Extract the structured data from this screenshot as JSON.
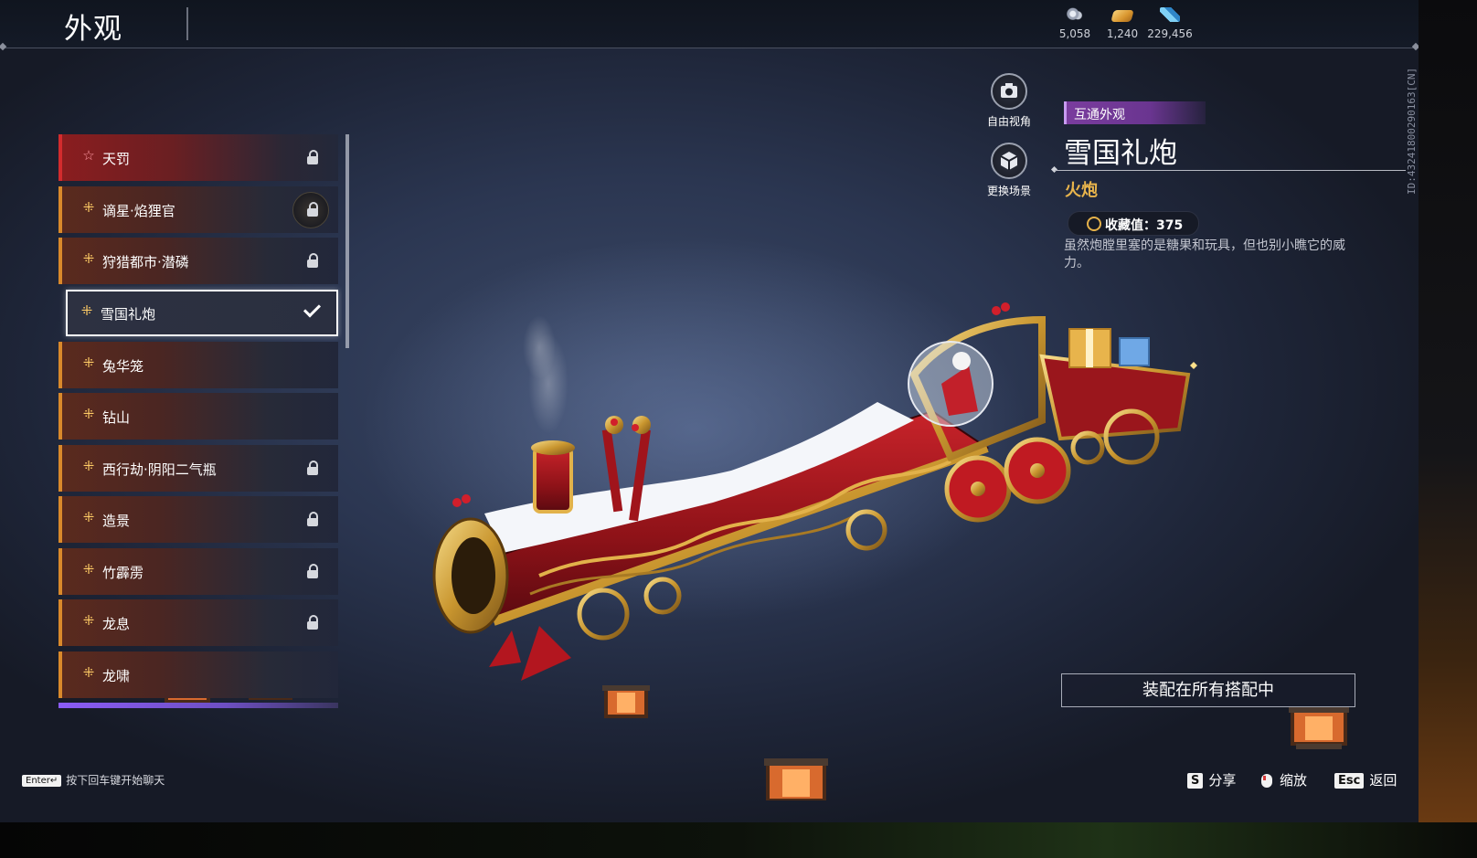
{
  "header": {
    "title": "外观",
    "currencies": [
      {
        "icon": "silver-coin-icon",
        "value": "5,058",
        "color": "#b9bfcc"
      },
      {
        "icon": "gold-ticket-icon",
        "value": "1,240",
        "color": "#e8b04a"
      },
      {
        "icon": "feather-crystal-icon",
        "value": "229,456",
        "color": "#5fb6e8"
      }
    ]
  },
  "side_id": "ID:4324180029016З[CN]",
  "skin_list": {
    "items": [
      {
        "label": "天罚",
        "icon": "star-icon",
        "locked": true,
        "rarity": "red"
      },
      {
        "label": "谪星·焰狸官",
        "icon": "rune-icon",
        "locked": true,
        "rarity": "gold"
      },
      {
        "label": "狩猎都市·潜磷",
        "icon": "rune-icon",
        "locked": true,
        "rarity": "gold"
      },
      {
        "label": "雪国礼炮",
        "icon": "rune-icon",
        "locked": false,
        "selected": true,
        "rarity": "gold"
      },
      {
        "label": "兔华笼",
        "icon": "rune-icon",
        "locked": false,
        "rarity": "gold"
      },
      {
        "label": "钻山",
        "icon": "rune-icon",
        "locked": false,
        "rarity": "gold"
      },
      {
        "label": "西行劫·阴阳二气瓶",
        "icon": "rune-icon",
        "locked": true,
        "rarity": "gold"
      },
      {
        "label": "造景",
        "icon": "rune-icon",
        "locked": true,
        "rarity": "gold"
      },
      {
        "label": "竹霹雳",
        "icon": "rune-icon",
        "locked": true,
        "rarity": "gold"
      },
      {
        "label": "龙息",
        "icon": "rune-icon",
        "locked": true,
        "rarity": "gold"
      },
      {
        "label": "龙啸",
        "icon": "rune-icon",
        "locked": false,
        "rarity": "gold"
      }
    ]
  },
  "view_controls": {
    "free_camera_label": "自由视角",
    "change_scene_label": "更换场景"
  },
  "details": {
    "tag": "互通外观",
    "name": "雪国礼炮",
    "type": "火炮",
    "collection_label": "收藏值：375",
    "description": "虽然炮膛里塞的是糖果和玩具，但也别小瞧它的威力。",
    "equip_button": "装配在所有搭配中"
  },
  "footer": {
    "chat_key": "Enter↵",
    "chat_hint": "按下回车键开始聊天",
    "share_key": "S",
    "share_label": "分享",
    "zoom_label": "缩放",
    "back_key": "Esc",
    "back_label": "返回"
  },
  "colors": {
    "accent_gold": "#e8b44c",
    "tag_purple": "#7a3d9e",
    "rarity_red": "#d32b2d",
    "rarity_gold": "#d9892b"
  }
}
